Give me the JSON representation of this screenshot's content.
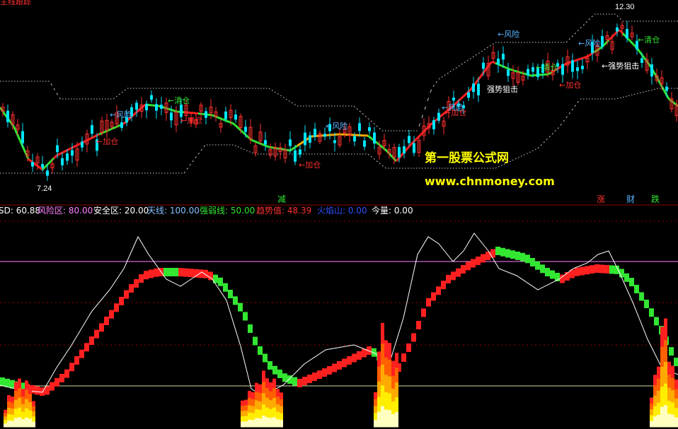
{
  "header": {
    "title": "主线跟踪",
    "high_label": "12.30",
    "low_label": "7.24"
  },
  "annotations": [
    {
      "text": "←风险",
      "color": "#5ab4ff"
    },
    {
      "text": "←清仓",
      "color": "#32e632"
    },
    {
      "text": "←加仓",
      "color": "#ff3030"
    },
    {
      "text": "←风险",
      "color": "#5ab4ff"
    },
    {
      "text": "←加仓",
      "color": "#ff3030"
    },
    {
      "text": "←风险",
      "color": "#5ab4ff"
    },
    {
      "text": "←加仓",
      "color": "#ff3030"
    },
    {
      "text": "←加仓",
      "color": "#ff3030"
    },
    {
      "text": "←风险",
      "color": "#5ab4ff"
    },
    {
      "text": "强势狙击",
      "color": "#ffffff"
    },
    {
      "text": "←清仓",
      "color": "#32e632"
    },
    {
      "text": "←加仓",
      "color": "#ff3030"
    },
    {
      "text": "←风险",
      "color": "#5ab4ff"
    },
    {
      "text": "←强势狙击",
      "color": "#ffffff"
    },
    {
      "text": "←清仓",
      "color": "#32e632"
    }
  ],
  "watermark": {
    "line1": "第一股票公式网",
    "line2": "www.chnmoney.com"
  },
  "markers": [
    {
      "text": "减",
      "color": "#32e632"
    },
    {
      "text": "涨",
      "color": "#ff3030"
    },
    {
      "text": "财",
      "color": "#5ab4ff"
    },
    {
      "text": "跌",
      "color": "#32e632"
    }
  ],
  "indicator_bar": [
    {
      "text": "SD: 60.88",
      "color": "#ffffff"
    },
    {
      "text": "风险区: 80.00",
      "color": "#ff80ff"
    },
    {
      "text": "安全区: 20.00",
      "color": "#ffffff"
    },
    {
      "text": "天线: 100.00",
      "color": "#80c0ff"
    },
    {
      "text": "强弱线: 50.00",
      "color": "#32e632"
    },
    {
      "text": "趋势值: 48.39",
      "color": "#ff3030"
    },
    {
      "text": "火焰山: 0.00",
      "color": "#3050ff"
    },
    {
      "text": "今量: 0.00",
      "color": "#ffffff"
    }
  ],
  "colors": {
    "up": "#ff3030",
    "down": "#00e5ff",
    "trend_up": "#ff2020",
    "trend_down": "#32e632",
    "risk_line": "#ff80ff"
  }
}
